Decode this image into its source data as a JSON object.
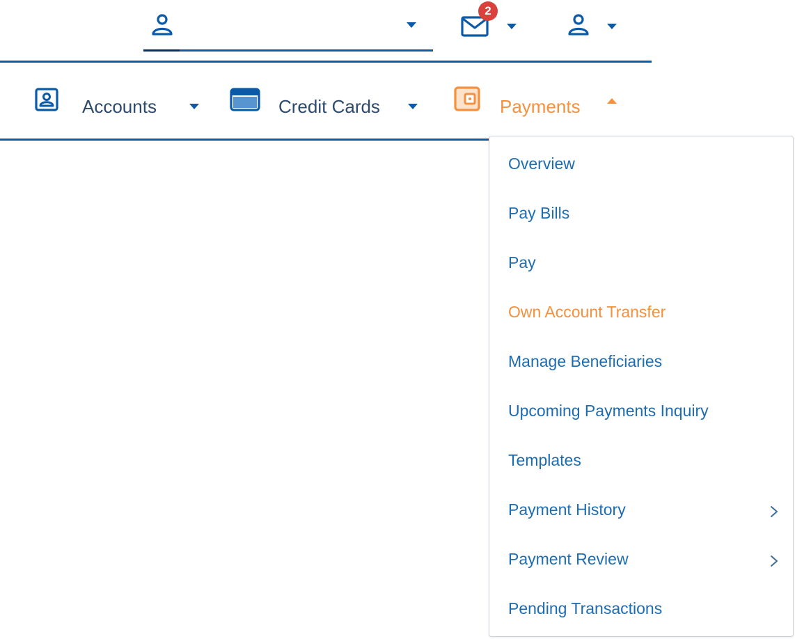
{
  "topbar": {
    "user_select": {
      "icon": "user-icon",
      "value": "",
      "caret_icon": "caret-down-icon"
    },
    "mail": {
      "icon": "mail-icon",
      "badge_count": "2",
      "caret_icon": "caret-down-icon"
    },
    "profile": {
      "icon": "user-icon",
      "caret_icon": "caret-down-icon"
    }
  },
  "nav": {
    "items": [
      {
        "label": "Accounts",
        "icon": "account-box-icon",
        "caret": "caret-down-icon",
        "active": false
      },
      {
        "label": "Credit Cards",
        "icon": "credit-card-icon",
        "caret": "caret-down-icon",
        "active": false
      },
      {
        "label": "Payments",
        "icon": "wallet-icon",
        "caret": "caret-up-icon",
        "active": true
      }
    ]
  },
  "payments_menu": {
    "items": [
      {
        "label": "Overview"
      },
      {
        "label": "Pay Bills"
      },
      {
        "label": "Pay"
      },
      {
        "label": "Own Account Transfer",
        "active": true
      },
      {
        "label": "Manage Beneficiaries"
      },
      {
        "label": "Upcoming Payments Inquiry"
      },
      {
        "label": "Templates"
      },
      {
        "label": "Payment History",
        "submenu": true
      },
      {
        "label": "Payment Review",
        "submenu": true
      },
      {
        "label": "Pending Transactions"
      }
    ]
  },
  "colors": {
    "primary": "#0b5aa8",
    "link": "#1e6cb0",
    "active": "#f5913e",
    "badge": "#d9423c",
    "text": "#2e4a6b"
  }
}
